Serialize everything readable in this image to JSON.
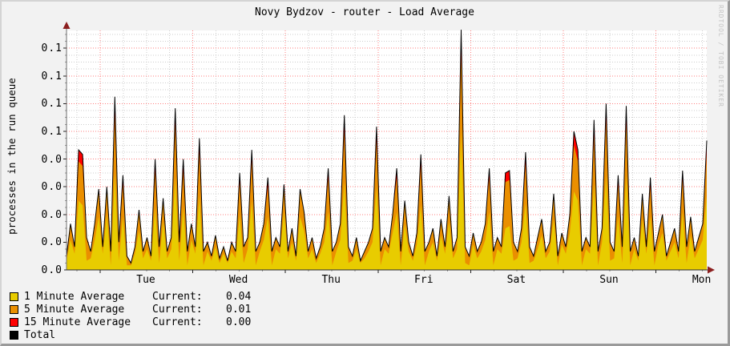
{
  "title": "Novy Bydzov - router - Load Average",
  "y_axis_label": "processes in the run queue",
  "watermark": "RRDTOOL / TOBI OETIKER",
  "y_tick_labels": [
    "0.1",
    "0.1",
    "0.1",
    "0.1",
    "0.0",
    "0.0",
    "0.0",
    "0.0",
    "0.0"
  ],
  "x_tick_labels": [
    "Tue",
    "Wed",
    "Thu",
    "Fri",
    "Sat",
    "Sun",
    "Mon"
  ],
  "legend": {
    "rows": [
      {
        "swatch_color": "#E8CC00",
        "label": "1 Minute Average",
        "current_label": "Current:",
        "value": "0.04"
      },
      {
        "swatch_color": "#EA8F00",
        "label": "5 Minute Average",
        "current_label": "Current:",
        "value": "0.01"
      },
      {
        "swatch_color": "#FF0000",
        "label": "15 Minute Average",
        "current_label": "Current:",
        "value": "0.00"
      },
      {
        "swatch_color": "#000000",
        "label": "Total",
        "current_label": "",
        "value": ""
      }
    ]
  },
  "chart_data": {
    "type": "area",
    "stacked": true,
    "title": "Novy Bydzov - router - Load Average",
    "ylabel": "processes in the run queue",
    "xlabel": "",
    "x_categories_days": [
      "Tue",
      "Wed",
      "Thu",
      "Fri",
      "Sat",
      "Sun",
      "Mon"
    ],
    "x_span": "one week, Monday afternoon to Monday afternoon, 160 evenly spaced samples",
    "ylim": [
      0,
      0.105
    ],
    "y_tick_step": 0.012,
    "y_tick_labels_displayed": [
      "0.0",
      "0.0",
      "0.0",
      "0.0",
      "0.0",
      "0.1",
      "0.1",
      "0.1",
      "0.1"
    ],
    "grid": {
      "major_color": "#ff7f7f",
      "minor_color": "#cdcdcd",
      "style": "dotted"
    },
    "legend_position": "bottom-left",
    "value_unit": "load (array values are thousandths; divide by 1000)",
    "series": [
      {
        "name": "1 Minute Average",
        "color": "#E8CC00",
        "role": "stack-bottom",
        "values": [
          4,
          13,
          7,
          30,
          28,
          4,
          5,
          13,
          23,
          7,
          24,
          2,
          42,
          4,
          23,
          2,
          2,
          7,
          17,
          5,
          9,
          4,
          27,
          3,
          21,
          5,
          9,
          40,
          4,
          27,
          2,
          13,
          7,
          32,
          2,
          8,
          4,
          10,
          3,
          7,
          3,
          8,
          5,
          24,
          3,
          9,
          30,
          2,
          8,
          13,
          23,
          2,
          9,
          7,
          25,
          5,
          12,
          4,
          23,
          17,
          5,
          9,
          3,
          7,
          12,
          25,
          2,
          8,
          13,
          38,
          3,
          4,
          9,
          3,
          5,
          8,
          12,
          36,
          2,
          9,
          7,
          16,
          25,
          2,
          20,
          8,
          4,
          11,
          28,
          2,
          8,
          12,
          4,
          15,
          7,
          21,
          5,
          9,
          60,
          3,
          2,
          11,
          5,
          8,
          13,
          25,
          2,
          9,
          7,
          18,
          19,
          4,
          5,
          12,
          29,
          3,
          4,
          9,
          15,
          5,
          8,
          22,
          2,
          11,
          7,
          16,
          34,
          30,
          2,
          9,
          7,
          37,
          2,
          12,
          41,
          4,
          5,
          23,
          3,
          41,
          2,
          9,
          4,
          22,
          7,
          23,
          2,
          11,
          16,
          4,
          8,
          12,
          5,
          25,
          3,
          15,
          5,
          9,
          13,
          32
        ]
      },
      {
        "name": "5 Minute Average",
        "color": "#EA8F00",
        "role": "stack-middle",
        "values": [
          2,
          7,
          3,
          17,
          17,
          10,
          3,
          7,
          12,
          3,
          12,
          6,
          25,
          8,
          14,
          4,
          1,
          3,
          9,
          3,
          5,
          2,
          16,
          7,
          10,
          3,
          5,
          23,
          8,
          16,
          6,
          7,
          3,
          19,
          6,
          4,
          2,
          5,
          2,
          3,
          1,
          4,
          3,
          14,
          7,
          5,
          17,
          6,
          4,
          7,
          13,
          6,
          5,
          3,
          12,
          3,
          6,
          2,
          12,
          8,
          3,
          5,
          2,
          3,
          6,
          15,
          6,
          4,
          7,
          22,
          7,
          2,
          5,
          1,
          3,
          4,
          6,
          20,
          6,
          5,
          3,
          8,
          15,
          6,
          10,
          4,
          2,
          5,
          17,
          6,
          4,
          6,
          2,
          7,
          3,
          11,
          3,
          5,
          34,
          7,
          4,
          5,
          3,
          4,
          7,
          15,
          6,
          5,
          3,
          20,
          20,
          8,
          3,
          6,
          17,
          7,
          2,
          5,
          7,
          3,
          4,
          11,
          4,
          5,
          3,
          8,
          20,
          17,
          6,
          5,
          3,
          21,
          6,
          6,
          24,
          8,
          3,
          14,
          7,
          23,
          6,
          5,
          2,
          11,
          3,
          13,
          6,
          5,
          8,
          2,
          4,
          6,
          3,
          14,
          7,
          8,
          3,
          5,
          7,
          18
        ]
      },
      {
        "name": "15 Minute Average",
        "color": "#FF0000",
        "role": "stack-top",
        "values": [
          0,
          0,
          0,
          5,
          5,
          0,
          0,
          0,
          0,
          0,
          0,
          0,
          8,
          0,
          4,
          0,
          0,
          0,
          0,
          0,
          0,
          0,
          5,
          0,
          0,
          0,
          0,
          7,
          0,
          5,
          0,
          0,
          0,
          6,
          0,
          0,
          0,
          0,
          0,
          0,
          0,
          0,
          0,
          4,
          0,
          0,
          5,
          0,
          0,
          0,
          4,
          0,
          0,
          0,
          0,
          0,
          0,
          0,
          0,
          0,
          0,
          0,
          0,
          0,
          0,
          4,
          0,
          0,
          0,
          7,
          0,
          0,
          0,
          0,
          0,
          0,
          0,
          6,
          0,
          0,
          0,
          0,
          4,
          0,
          0,
          0,
          0,
          0,
          5,
          0,
          0,
          0,
          0,
          0,
          0,
          0,
          0,
          0,
          10,
          0,
          0,
          0,
          0,
          0,
          0,
          4,
          0,
          0,
          0,
          4,
          4,
          0,
          0,
          0,
          5,
          0,
          0,
          0,
          0,
          0,
          0,
          0,
          0,
          0,
          0,
          0,
          6,
          5,
          0,
          0,
          0,
          7,
          0,
          0,
          7,
          0,
          0,
          4,
          0,
          7,
          0,
          0,
          0,
          0,
          0,
          4,
          0,
          0,
          0,
          0,
          0,
          0,
          0,
          4,
          0,
          0,
          0,
          0,
          0,
          6
        ]
      },
      {
        "name": "Total",
        "color": "#000000",
        "role": "line",
        "derived": "sum of the three stacked series"
      }
    ],
    "currents": {
      "1 Minute Average": "0.04",
      "5 Minute Average": "0.01",
      "15 Minute Average": "0.00"
    }
  },
  "colors": {
    "background": "#f2f2f2",
    "plot_background": "#ffffff",
    "bevel_light": "#d4d4d4",
    "bevel_dark": "#9a9a9a",
    "major_grid": "#ff7f7f",
    "minor_grid": "#cdcdcd",
    "axis": "#6e6e6e",
    "arrow": "#8c1f1f",
    "watermark_text": "#c4c4c4"
  }
}
